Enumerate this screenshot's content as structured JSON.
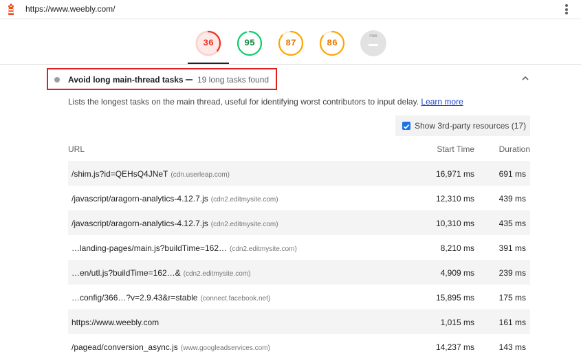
{
  "topbar": {
    "url": "https://www.weebly.com/"
  },
  "scores": [
    {
      "value": "36",
      "status": "fail",
      "color": "#eb3323",
      "fraction": 0.36
    },
    {
      "value": "95",
      "status": "pass",
      "color": "#0cce6b",
      "fraction": 0.95
    },
    {
      "value": "87",
      "status": "average",
      "color": "#ffa400",
      "fraction": 0.87
    },
    {
      "value": "86",
      "status": "average",
      "color": "#ffa400",
      "fraction": 0.86
    },
    {
      "value": "",
      "status": "pwa",
      "label": "PWA"
    }
  ],
  "audit": {
    "title": "Avoid long main-thread tasks",
    "display_value": "19 long tasks found",
    "description": "Lists the longest tasks on the main thread, useful for identifying worst contributors to input delay.",
    "learn_more": "Learn more"
  },
  "filter": {
    "label": "Show 3rd-party resources (17)",
    "checked": true
  },
  "table": {
    "headers": {
      "url": "URL",
      "start": "Start Time",
      "duration": "Duration"
    },
    "rows": [
      {
        "url": "/shim.js?id=QEHsQ4JNeT",
        "host": "(cdn.userleap.com)",
        "start": "16,971 ms",
        "duration": "691 ms"
      },
      {
        "url": "/javascript/aragorn-analytics-4.12.7.js",
        "host": "(cdn2.editmysite.com)",
        "start": "12,310 ms",
        "duration": "439 ms"
      },
      {
        "url": "/javascript/aragorn-analytics-4.12.7.js",
        "host": "(cdn2.editmysite.com)",
        "start": "10,310 ms",
        "duration": "435 ms"
      },
      {
        "url": "…landing-pages/main.js?buildTime=162…",
        "host": "(cdn2.editmysite.com)",
        "start": "8,210 ms",
        "duration": "391 ms"
      },
      {
        "url": "…en/utl.js?buildTime=162…&",
        "host": "(cdn2.editmysite.com)",
        "start": "4,909 ms",
        "duration": "239 ms"
      },
      {
        "url": "…config/366…?v=2.9.43&r=stable",
        "host": "(connect.facebook.net)",
        "start": "15,895 ms",
        "duration": "175 ms"
      },
      {
        "url": "https://www.weebly.com",
        "host": "",
        "start": "1,015 ms",
        "duration": "161 ms"
      },
      {
        "url": "/pagead/conversion_async.js",
        "host": "(www.googleadservices.com)",
        "start": "14,237 ms",
        "duration": "143 ms"
      }
    ]
  }
}
